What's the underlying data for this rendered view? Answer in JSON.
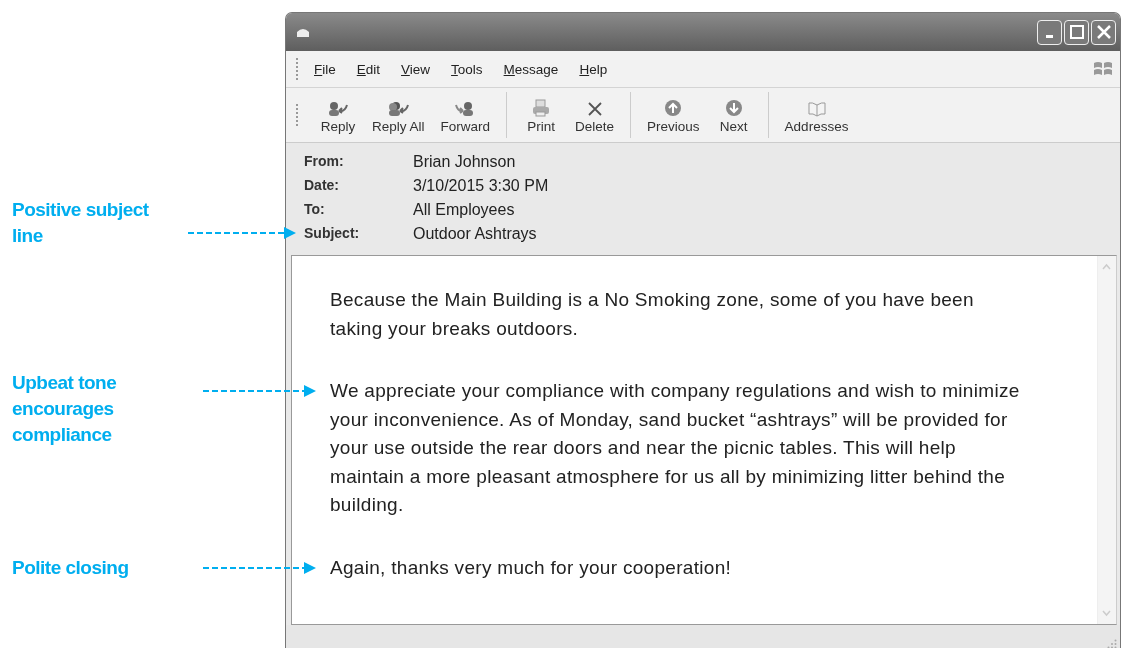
{
  "annotations": [
    {
      "text": "Positive subject line"
    },
    {
      "text": "Upbeat tone encourages compliance"
    },
    {
      "text": "Polite closing"
    }
  ],
  "window": {
    "menu": [
      "File",
      "Edit",
      "View",
      "Tools",
      "Message",
      "Help"
    ],
    "toolbar": [
      [
        {
          "label": "Reply",
          "kind": "reply",
          "disabled": false
        },
        {
          "label": "Reply All",
          "kind": "reply_all",
          "disabled": false
        },
        {
          "label": "Forward",
          "kind": "forward",
          "disabled": false
        }
      ],
      [
        {
          "label": "Print",
          "kind": "print",
          "disabled": false
        },
        {
          "label": "Delete",
          "kind": "delete",
          "disabled": false
        }
      ],
      [
        {
          "label": "Previous",
          "kind": "previous",
          "disabled": false
        },
        {
          "label": "Next",
          "kind": "next",
          "disabled": false
        }
      ],
      [
        {
          "label": "Addresses",
          "kind": "addresses",
          "disabled": false
        }
      ]
    ],
    "header": [
      {
        "label": "From:",
        "value": "Brian Johnson"
      },
      {
        "label": "Date:",
        "value": "3/10/2015 3:30 PM"
      },
      {
        "label": "To:",
        "value": "All Employees"
      },
      {
        "label": "Subject:",
        "value": "Outdoor Ashtrays"
      }
    ],
    "body": [
      "Because the Main Building is a No Smoking zone, some of you have been taking your breaks outdoors.",
      "We appreciate your compliance with company regulations and wish to minimize your inconvenience. As of Monday, sand bucket “ashtrays” will be provided for your use outside the rear doors and near the picnic tables. This will help maintain a more pleasant atmosphere for us all by minimizing litter behind the building.",
      "Again, thanks very much for your cooperation!"
    ]
  }
}
